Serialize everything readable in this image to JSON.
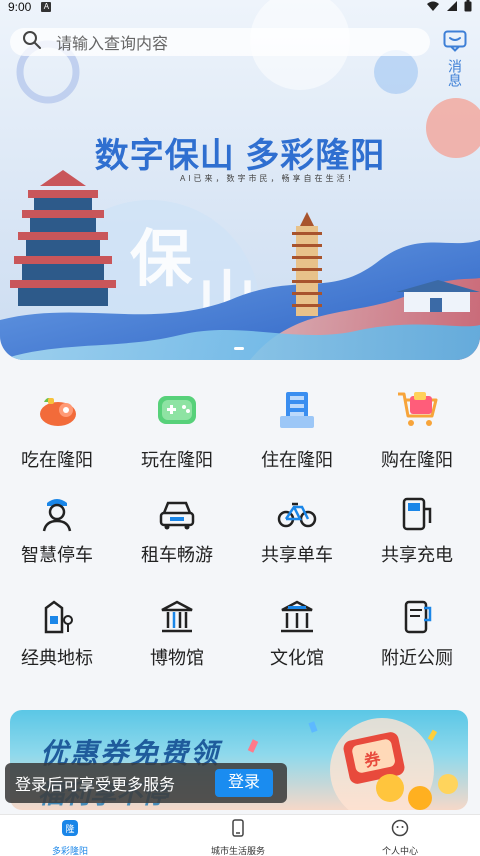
{
  "status_bar": {
    "time": "9:00",
    "notif": "A"
  },
  "search": {
    "placeholder": "请输入查询内容"
  },
  "message": {
    "label": "消息"
  },
  "banner": {
    "title": "数字保山 多彩隆阳",
    "subtitle": "AI已来，数字市民，畅享自在生活！",
    "art_text": "保山"
  },
  "grid": [
    [
      {
        "label": "吃在隆阳",
        "icon": "food-icon"
      },
      {
        "label": "玩在隆阳",
        "icon": "game-icon"
      },
      {
        "label": "住在隆阳",
        "icon": "hotel-icon"
      },
      {
        "label": "购在隆阳",
        "icon": "cart-icon"
      }
    ],
    [
      {
        "label": "智慧停车",
        "icon": "parking-attendant-icon"
      },
      {
        "label": "租车畅游",
        "icon": "car-icon"
      },
      {
        "label": "共享单车",
        "icon": "bicycle-icon"
      },
      {
        "label": "共享充电",
        "icon": "charging-station-icon"
      }
    ],
    [
      {
        "label": "经典地标",
        "icon": "landmark-icon"
      },
      {
        "label": "博物馆",
        "icon": "museum-icon"
      },
      {
        "label": "文化馆",
        "icon": "culture-hall-icon"
      },
      {
        "label": "附近公厕",
        "icon": "restroom-icon"
      }
    ]
  ],
  "promo": {
    "title": "优惠券免费领",
    "subtitle": "福利享不停",
    "coupon_text": "券"
  },
  "login_prompt": {
    "text": "登录后可享受更多服务",
    "button": "登录"
  },
  "tabbar": [
    {
      "label": "多彩隆阳",
      "icon_text": "隆",
      "active": true
    },
    {
      "label": "城市生活服务",
      "active": false
    },
    {
      "label": "个人中心",
      "active": false
    }
  ],
  "colors": {
    "accent": "#1a86e8",
    "banner_title": "#2f6fd0"
  }
}
